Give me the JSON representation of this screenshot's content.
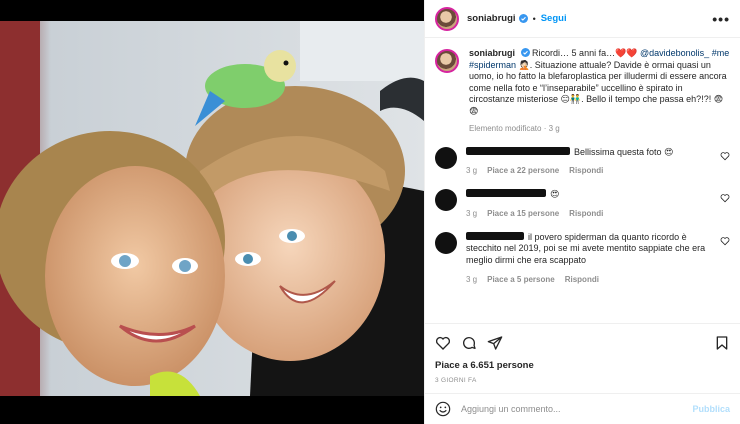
{
  "post": {
    "username": "soniabrugi",
    "follow_label": "Segui",
    "dot": "•",
    "more": "•••"
  },
  "caption": {
    "username": "soniabrugi",
    "text_a": "Ricordi… 5 anni fa…❤️❤️ ",
    "mention": "@davidebonolis_",
    "tag1": "#me",
    "tag2": "#spiderman",
    "text_b": " 🤦🏻. Situazione attuale? Davide è ormai quasi un uomo, io ho fatto la blefaroplastica per illudermi di essere ancora come nella foto e “l’inseparabile” uccellino è spirato in circostanze misteriose 😑👬. Bello il tempo che passa eh?!?! 😨😨",
    "edited": "Elemento modificato",
    "edited_time": "3 g",
    "sep": "·"
  },
  "comments": [
    {
      "text": "Bellissima questa foto 😍",
      "time": "3 g",
      "likes": "Piace a 22 persone",
      "reply": "Rispondi"
    },
    {
      "text": "😍",
      "time": "3 g",
      "likes": "Piace a 15 persone",
      "reply": "Rispondi"
    },
    {
      "text": "il povero spiderman da quanto ricordo è stecchito nel 2019, poi se mi avete mentito sappiate che era meglio dirmi che era scappato",
      "time": "3 g",
      "likes": "Piace a 5 persone",
      "reply": "Rispondi"
    }
  ],
  "actions": {
    "likes": "Piace a 6.651 persone",
    "date": "3 GIORNI FA"
  },
  "add_comment": {
    "placeholder": "Aggiungi un commento...",
    "publish": "Pubblica"
  },
  "colors": {
    "accent": "#0095f6",
    "tag": "#00376b",
    "muted": "#8e8e8e"
  },
  "icons": [
    "verified-icon",
    "more-icon",
    "heart-icon",
    "comment-icon",
    "share-icon",
    "bookmark-icon",
    "emoji-icon"
  ]
}
